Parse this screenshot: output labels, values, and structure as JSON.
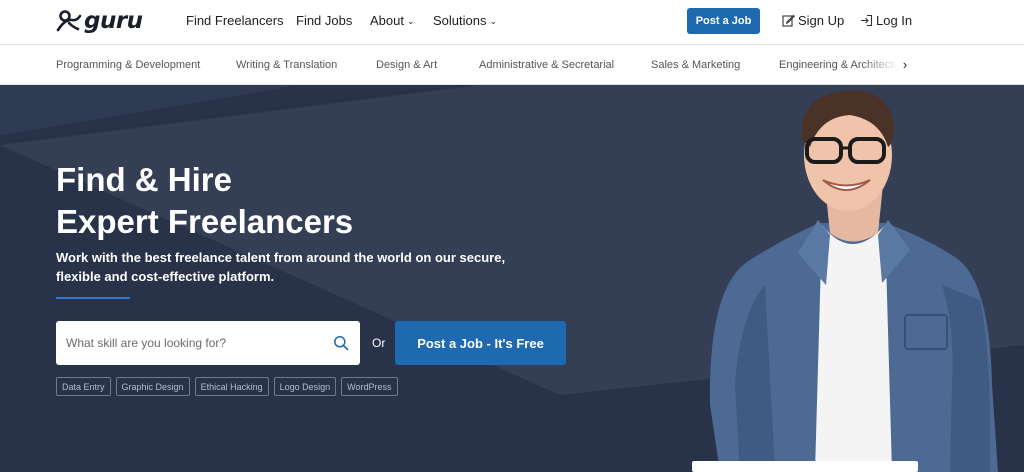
{
  "header": {
    "logo_text": "guru",
    "nav": [
      {
        "label": "Find Freelancers"
      },
      {
        "label": "Find Jobs"
      },
      {
        "label": "About"
      },
      {
        "label": "Solutions"
      }
    ],
    "post_job_label": "Post a Job",
    "signup_label": "Sign Up",
    "login_label": "Log In"
  },
  "categories": [
    "Programming & Development",
    "Writing & Translation",
    "Design & Art",
    "Administrative & Secretarial",
    "Sales & Marketing",
    "Engineering & Architecture"
  ],
  "hero": {
    "title_line1": "Find & Hire",
    "title_line2": "Expert Freelancers",
    "subtitle": "Work with the best freelance talent from around the world on our secure, flexible and cost-effective platform.",
    "search_placeholder": "What skill are you looking for?",
    "or_text": "Or",
    "cta_label": "Post a Job - It's Free",
    "tags": [
      "Data Entry",
      "Graphic Design",
      "Ethical Hacking",
      "Logo Design",
      "WordPress"
    ]
  },
  "colors": {
    "accent": "#1e69b0",
    "hero_bg": "#283349",
    "underline": "#2d7dd2"
  },
  "icons": {
    "logo": "guru-logo-icon",
    "search": "search-icon",
    "signup": "edit-icon",
    "login": "login-icon",
    "category_next": "chevron-right-icon"
  }
}
